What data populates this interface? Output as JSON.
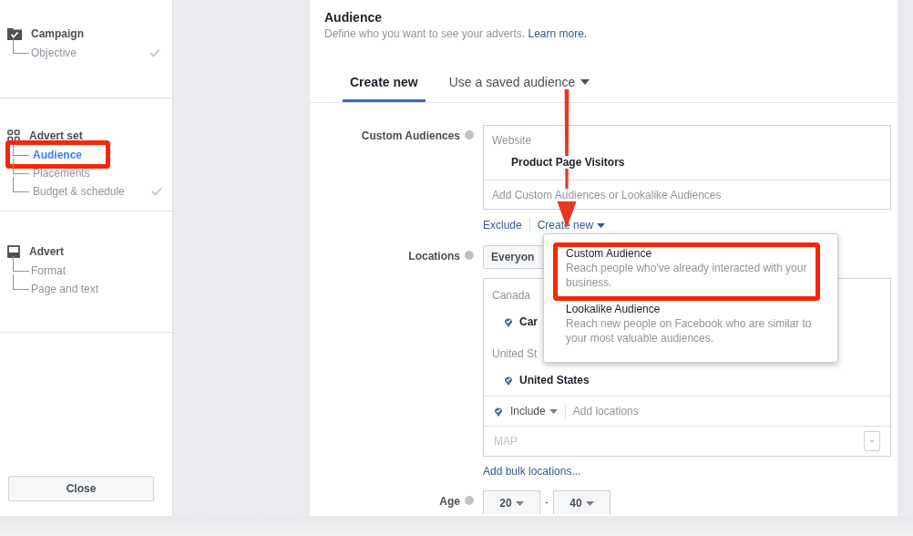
{
  "sidebar": {
    "sections": [
      {
        "kind": "campaign",
        "title": "Campaign",
        "items": [
          {
            "label": "Objective",
            "selected": false,
            "completed": true,
            "highlighted": false
          }
        ]
      },
      {
        "kind": "advert-set",
        "title": "Advert set",
        "items": [
          {
            "label": "Audience",
            "selected": true,
            "completed": false,
            "highlighted": true
          },
          {
            "label": "Placements",
            "selected": false,
            "completed": false,
            "highlighted": false
          },
          {
            "label": "Budget & schedule",
            "selected": false,
            "completed": true,
            "highlighted": false
          }
        ]
      },
      {
        "kind": "advert",
        "title": "Advert",
        "items": [
          {
            "label": "Format",
            "selected": false,
            "completed": false,
            "highlighted": false
          },
          {
            "label": "Page and text",
            "selected": false,
            "completed": false,
            "highlighted": false
          }
        ]
      }
    ],
    "close_button": "Close"
  },
  "header": {
    "title": "Audience",
    "subtitle": "Define who you want to see your adverts.",
    "link": "Learn more."
  },
  "tabs": [
    {
      "label": "Create new",
      "selected": true,
      "dropdown": false
    },
    {
      "label": "Use a saved audience",
      "selected": false,
      "dropdown": true
    }
  ],
  "custom_audiences": {
    "label": "Custom Audiences",
    "group": "Website",
    "items": [
      "Product Page Visitors"
    ],
    "placeholder": "Add Custom Audiences or Lookalike Audiences",
    "links": [
      {
        "label": "Exclude",
        "dropdown": false
      },
      {
        "label": "Create new",
        "dropdown": true
      }
    ]
  },
  "menu": [
    {
      "title": "Custom Audience",
      "description": "Reach people who've already interacted with your business.",
      "highlighted": true
    },
    {
      "title": "Lookalike Audience",
      "description": "Reach new people on Facebook who are similar to your most valuable audiences.",
      "highlighted": false
    }
  ],
  "locations": {
    "label": "Locations",
    "audience_button": "Everyon",
    "groups": [
      {
        "label": "Canada",
        "items": [
          "Car"
        ]
      },
      {
        "label": "United St",
        "items": [
          "United States"
        ]
      }
    ],
    "mode": "Include",
    "placeholder": "Add locations",
    "map": "MAP",
    "bulk_link": "Add bulk locations..."
  },
  "age": {
    "label": "Age",
    "from": "20",
    "separator": "-",
    "to": "40"
  }
}
